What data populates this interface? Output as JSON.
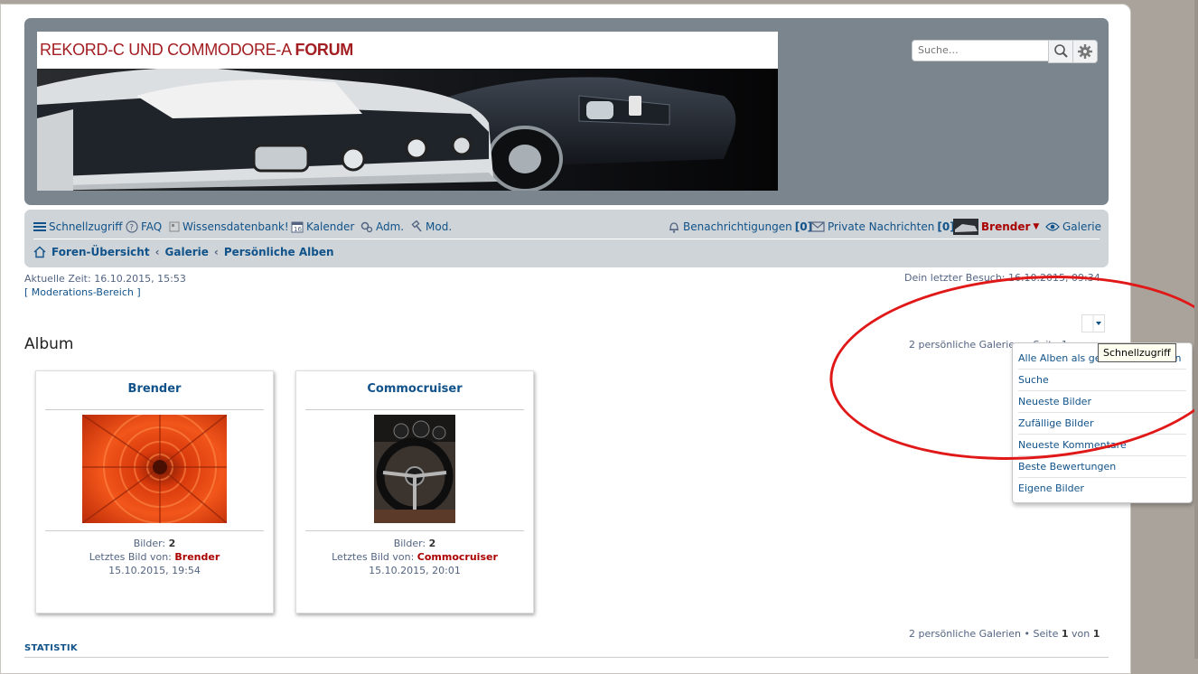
{
  "header": {
    "banner_title_prefix": "REKORD-C UND COMMODORE-A ",
    "banner_title_bold": "FORUM",
    "search_placeholder": "Suche…"
  },
  "nav": {
    "quicklinks": "Schnellzugriff",
    "faq": "FAQ",
    "kb": "Wissensdatenbank!",
    "calendar": "Kalender",
    "adm": "Adm.",
    "mod": "Mod.",
    "notifications": "Benachrichtigungen",
    "notifications_count": "[0]",
    "pm": "Private Nachrichten",
    "pm_count": "[0]",
    "username": "Brender",
    "gallery": "Galerie"
  },
  "breadcrumbs": [
    "Foren-Übersicht",
    "Galerie",
    "Persönliche Alben"
  ],
  "info": {
    "current_time": "Aktuelle Zeit: 16.10.2015, 15:53",
    "mod_area": "[ Moderations-Bereich ]",
    "last_visit": "Dein letzter Besuch: 16.10.2015, 09:34"
  },
  "album": {
    "title": "Album",
    "count_top": "2 persönliche Galerien • Seite 1",
    "count_bottom_prefix": "2 persönliche Galerien • Seite ",
    "page": "1",
    "of": " von ",
    "pages": "1"
  },
  "cards": [
    {
      "name": "Brender",
      "images_label": "Bilder: ",
      "images": "2",
      "last_label": "Letztes Bild von: ",
      "last_user": "Brender",
      "date": "15.10.2015, 19:54"
    },
    {
      "name": "Commocruiser",
      "images_label": "Bilder: ",
      "images": "2",
      "last_label": "Letztes Bild von: ",
      "last_user": "Commocruiser",
      "date": "15.10.2015, 20:01"
    }
  ],
  "statistik": "STATISTIK",
  "dropdown": {
    "items": [
      "Alle Alben als gelesen markieren",
      "Suche",
      "Neueste Bilder",
      "Zufällige Bilder",
      "Neueste Kommentare",
      "Beste Bewertungen",
      "Eigene Bilder"
    ],
    "tooltip": "Schnellzugriff"
  },
  "colors": {
    "link": "#105289",
    "username": "#aa0000",
    "header_bg": "#7a858e",
    "navbar_bg": "#cfd4d8",
    "annotation": "#e01818"
  }
}
